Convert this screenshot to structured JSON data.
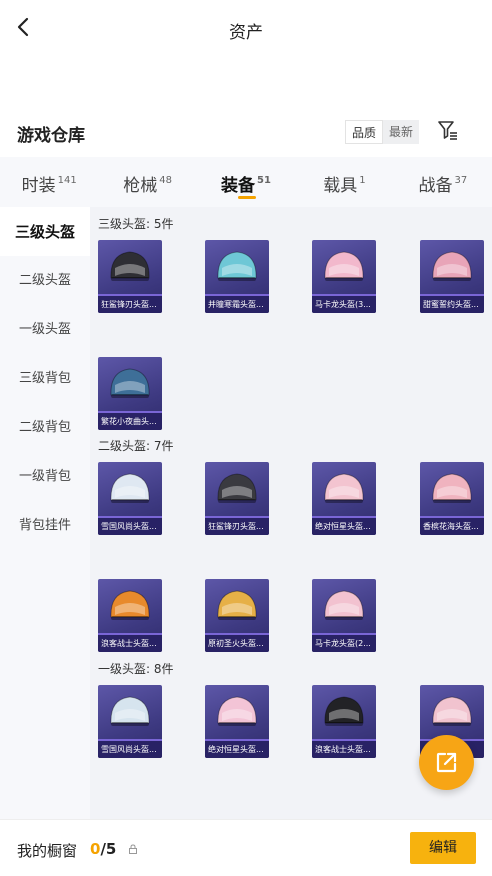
{
  "header": {
    "title": "资产"
  },
  "warehouse": {
    "title": "游戏仓库",
    "sort_quality": "品质",
    "sort_latest": "最新"
  },
  "tabs": [
    {
      "label": "时装",
      "count": "141"
    },
    {
      "label": "枪械",
      "count": "48"
    },
    {
      "label": "装备",
      "count": "51"
    },
    {
      "label": "载具",
      "count": "1"
    },
    {
      "label": "战备",
      "count": "37"
    }
  ],
  "sidebar": [
    "三级头盔",
    "二级头盔",
    "一级头盔",
    "三级背包",
    "二级背包",
    "一级背包",
    "背包挂件"
  ],
  "sections": [
    {
      "title": "三级头盔: 5件",
      "items": [
        "狂鲨锋刃头盔...",
        "并瞳寒霜头盔...",
        "马卡龙头盔(3...",
        "甜蜜誓约头盔...",
        "繁花小夜曲头..."
      ]
    },
    {
      "title": "二级头盔: 7件",
      "items": [
        "雪国风尚头盔...",
        "狂鲨锋刃头盔...",
        "绝对恒星头盔...",
        "香槟花海头盔...",
        "浪客战士头盔...",
        "原初圣火头盔...",
        "马卡龙头盔(2..."
      ]
    },
    {
      "title": "一级头盔: 8件",
      "items": [
        "雪国风尚头盔...",
        "绝对恒星头盔...",
        "浪客战士头盔...",
        "..."
      ]
    }
  ],
  "colors": {
    "accent": "#f5a300",
    "card_top": "#5d57a8",
    "card_bottom": "#2f2b6b",
    "helmets": [
      "#2e2e34",
      "#6ec7d6",
      "#f2b8cc",
      "#e8a4b8",
      "#3e6f98",
      "#dfe8f2",
      "#3a3a40",
      "#f3c4d0",
      "#f0b3bf",
      "#e88a2c",
      "#e6b047",
      "#f2c2d0",
      "#d6e4ee",
      "#f3c4d6",
      "#222226",
      "#f1c3cf"
    ]
  },
  "bottom": {
    "label": "我的橱窗",
    "current": "0",
    "total": "/5",
    "edit": "编辑"
  },
  "icons": [
    "back-arrow-icon",
    "filter-icon",
    "external-link-icon",
    "lock-icon"
  ]
}
